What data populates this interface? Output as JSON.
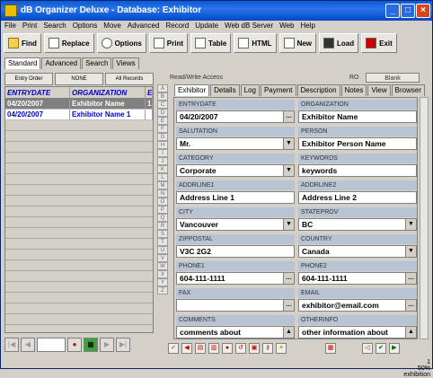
{
  "window": {
    "title": "dB Organizer Deluxe - Database: Exhibitor"
  },
  "menu": [
    "File",
    "Print",
    "Search",
    "Options",
    "Move",
    "Advanced",
    "Record",
    "Update",
    "Web dB Server",
    "Web",
    "Help"
  ],
  "toolbar": {
    "find": "Find",
    "replace": "Replace",
    "options": "Options",
    "print": "Print",
    "table": "Table",
    "html": "HTML",
    "new": "New",
    "load": "Load",
    "exit": "Exit"
  },
  "left_tabs": [
    "Standard",
    "Advanced",
    "Search",
    "Views"
  ],
  "sort_buttons": [
    "Entry Order",
    "NONE",
    "All Records"
  ],
  "grid": {
    "columns": [
      "ENTRYDATE",
      "ORGANIZATION",
      "E"
    ],
    "rows": [
      [
        "04/20/2007",
        "Exhibitor Name",
        "1"
      ],
      [
        "04/20/2007",
        "Exhibitor Name 1",
        ""
      ]
    ]
  },
  "letters": [
    "A",
    "B",
    "C",
    "D",
    "E",
    "F",
    "G",
    "H",
    "I",
    "J",
    "K",
    "L",
    "M",
    "N",
    "O",
    "P",
    "Q",
    "R",
    "S",
    "T",
    "U",
    "V",
    "W",
    "X",
    "Y",
    "Z"
  ],
  "access": "Read/Write Access",
  "ro_label": "RO",
  "blank_label": "Blank",
  "right_tabs": [
    "Exhibitor",
    "Details",
    "Log",
    "Payment",
    "Description",
    "Notes",
    "View",
    "Browser"
  ],
  "fields": {
    "entrydate": {
      "label": "ENTRYDATE",
      "value": "04/20/2007"
    },
    "organization": {
      "label": "ORGANIZATION",
      "value": "Exhibitor Name"
    },
    "salutation": {
      "label": "SALUTATION",
      "value": "Mr."
    },
    "person": {
      "label": "PERSON",
      "value": "Exhibitor Person Name"
    },
    "category": {
      "label": "CATEGORY",
      "value": "Corporate"
    },
    "keywords": {
      "label": "KEYWORDS",
      "value": "keywords"
    },
    "addrline1": {
      "label": "ADDRLINE1",
      "value": "Address Line 1"
    },
    "addrline2": {
      "label": "ADDRLINE2",
      "value": "Address Line 2"
    },
    "city": {
      "label": "CITY",
      "value": "Vancouver"
    },
    "stateprov": {
      "label": "STATEPROV",
      "value": "BC"
    },
    "zippostal": {
      "label": "ZIPPOSTAL",
      "value": "V3C 2G2"
    },
    "country": {
      "label": "COUNTRY",
      "value": "Canada"
    },
    "phone1": {
      "label": "PHONE1",
      "value": "604-111-1111"
    },
    "phone2": {
      "label": "PHONE2",
      "value": "604-111-1111"
    },
    "fax": {
      "label": "FAX",
      "value": ""
    },
    "email": {
      "label": "EMAIL",
      "value": "exhibitor@email.com"
    },
    "comments": {
      "label": "COMMENTS",
      "value": "comments about"
    },
    "otherinfo": {
      "label": "OTHERINFO",
      "value": "other information about"
    }
  },
  "status": {
    "record": "1",
    "zoom": "50%",
    "table": "exhibition"
  }
}
